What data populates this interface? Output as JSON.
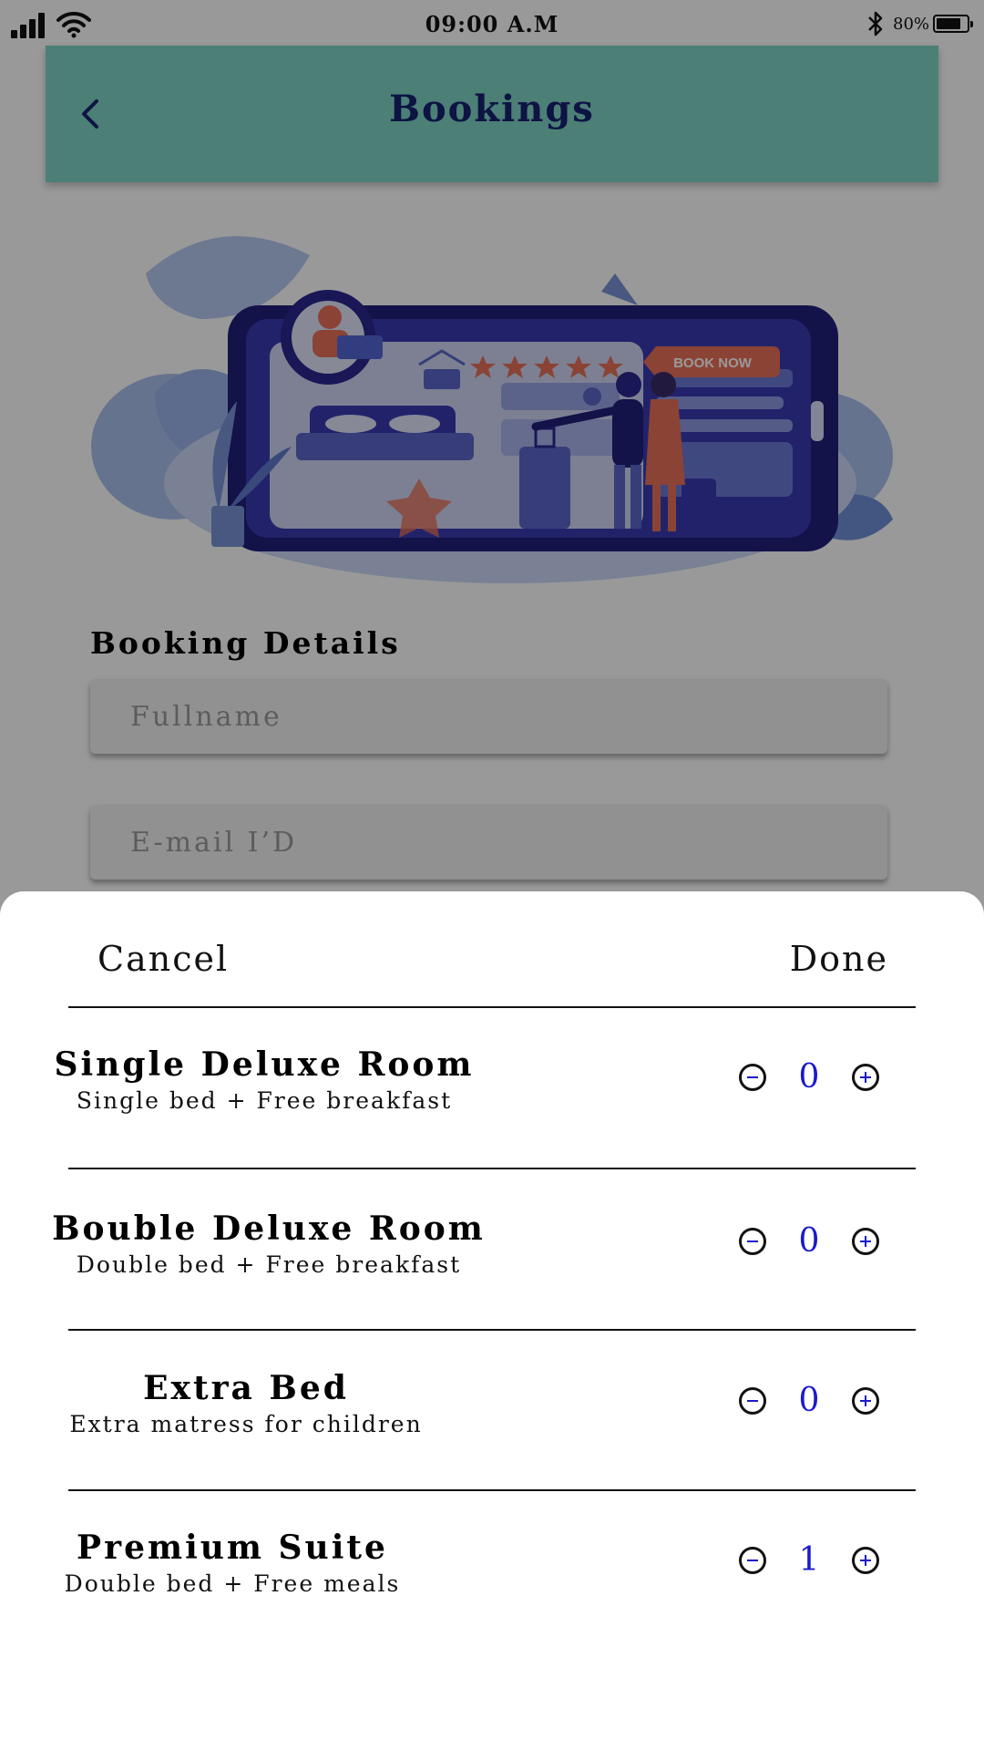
{
  "status_bar": {
    "time": "09:00 A.M",
    "battery": "80%",
    "battery_level": 0.8
  },
  "header": {
    "title": "Bookings"
  },
  "hero": {
    "badge_text": "BOOK NOW"
  },
  "booking_details": {
    "title": "Booking Details",
    "fullname_placeholder": "Fullname",
    "email_placeholder": "E-mail I’D"
  },
  "sheet": {
    "cancel_label": "Cancel",
    "done_label": "Done",
    "rooms": [
      {
        "name": "Single Deluxe Room",
        "description": "Single bed + Free breakfast",
        "quantity": "0"
      },
      {
        "name": "Bouble Deluxe Room",
        "description": "Double bed + Free breakfast",
        "quantity": "0"
      },
      {
        "name": "Extra Bed",
        "description": "Extra matress for children",
        "quantity": "0"
      },
      {
        "name": "Premium Suite",
        "description": "Double bed + Free meals",
        "quantity": "1"
      }
    ]
  },
  "colors": {
    "header_bg": "#7fd4c5",
    "title_text": "#172070",
    "accent_blue": "#1a1acc",
    "hero_orange": "#e87059"
  }
}
